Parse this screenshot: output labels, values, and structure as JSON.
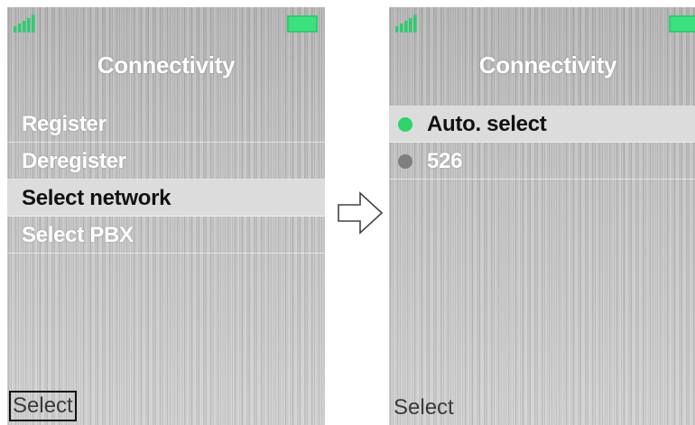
{
  "left_screen": {
    "title": "Connectivity",
    "menu": [
      {
        "label": "Register",
        "selected": false
      },
      {
        "label": "Deregister",
        "selected": false
      },
      {
        "label": "Select network",
        "selected": true
      },
      {
        "label": "Select PBX",
        "selected": false
      }
    ],
    "softkey": "Select"
  },
  "right_screen": {
    "title": "Connectivity",
    "options": [
      {
        "label": "Auto. select",
        "checked": true
      },
      {
        "label": "526",
        "checked": false
      }
    ],
    "softkey": "Select"
  },
  "colors": {
    "signal": "#2ecc71",
    "battery": "#2ecc71",
    "radio_on": "#2ed46a",
    "radio_off": "#7f7f7f",
    "highlight": "#dcdcdc"
  },
  "icons": {
    "signal": "signal-bars-icon",
    "battery": "battery-icon",
    "transition": "arrow-right-icon"
  }
}
